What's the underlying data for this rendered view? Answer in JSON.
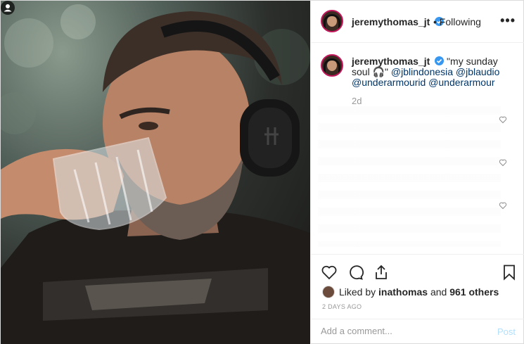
{
  "post": {
    "username": "jeremythomas_jt",
    "follow_separator": "•",
    "follow_status": "Following",
    "more_label": "•••",
    "caption": {
      "username": "jeremythomas_jt",
      "text": " \"my sunday soul 🎧\" ",
      "mentions": [
        "@jblindonesia",
        "@jblaudio",
        "@underarmourid",
        "@underarmour"
      ],
      "time": "2d"
    },
    "likes": {
      "prefix": "Liked by ",
      "user": "inathomas",
      "middle": " and ",
      "count": "961 others"
    },
    "date": "2 DAYS AGO",
    "comment": {
      "placeholder": "Add a comment...",
      "post_label": "Post"
    },
    "icons": {
      "like": "heart-icon",
      "comment": "comment-icon",
      "share": "share-icon",
      "save": "bookmark-icon",
      "verified": "verified-badge-icon",
      "user_tag": "user-tag-icon"
    },
    "colors": {
      "verified": "#3897f0",
      "link": "#003569",
      "post_disabled": "#b2dffc"
    }
  }
}
